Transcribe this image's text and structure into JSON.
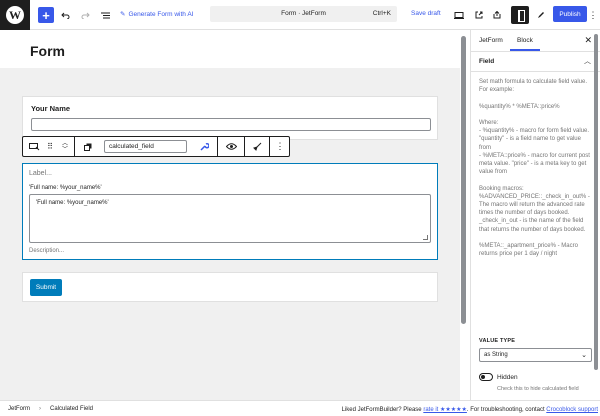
{
  "toolbar": {
    "generate_ai": "Generate Form with AI",
    "doc_title": "Form · JetForm",
    "shortcut": "Ctrl+K",
    "save_draft": "Save draft",
    "publish": "Publish"
  },
  "editor": {
    "post_title": "Form",
    "name_field": {
      "label": "Your Name",
      "value": ""
    },
    "block_toolbar": {
      "field_name": "calculated_field"
    },
    "calc_field": {
      "label_placeholder": "Label...",
      "formula_preview": "'Full name: %your_name%'",
      "formula_value": "'Full name: %your_name%'",
      "description_placeholder": "Description..."
    },
    "submit_label": "Submit"
  },
  "sidebar": {
    "tabs": [
      "JetForm",
      "Block"
    ],
    "active_tab": "Block",
    "section_title": "Field",
    "help_text": "Set math formula to calculate field value.\nFor example:\n\n%quantity% * %META::price%\n\nWhere:\n- %quantity% - macro for form field value. \"quantity\" - is a field name to get value from\n- %META::price% - macro for current post meta value. \"price\" - is a meta key to get value from\n\nBooking macros:\n%ADVANCED_PRICE::_check_in_out% - The macro will return the advanced rate times the number of days booked. _check_in_out - is the name of the field that returns the number of days booked.\n\n%META::_apartment_price% - Macro returns price per 1 day / night",
    "value_type_label": "VALUE TYPE",
    "value_type_selected": "as String",
    "hidden_label": "Hidden",
    "hidden_help": "Check this to hide calculated field"
  },
  "footer": {
    "breadcrumb": [
      "JetForm",
      "Calculated Field"
    ],
    "message_prefix": "Liked JetFormBuilder? Please ",
    "rate_link": "rate it ★★★★★",
    "message_mid": ". For troubleshooting, contact ",
    "support_link": "Crocoblock support"
  },
  "colors": {
    "accent": "#3858e9",
    "focus_blue": "#007cba",
    "dark": "#1e1e1e"
  }
}
